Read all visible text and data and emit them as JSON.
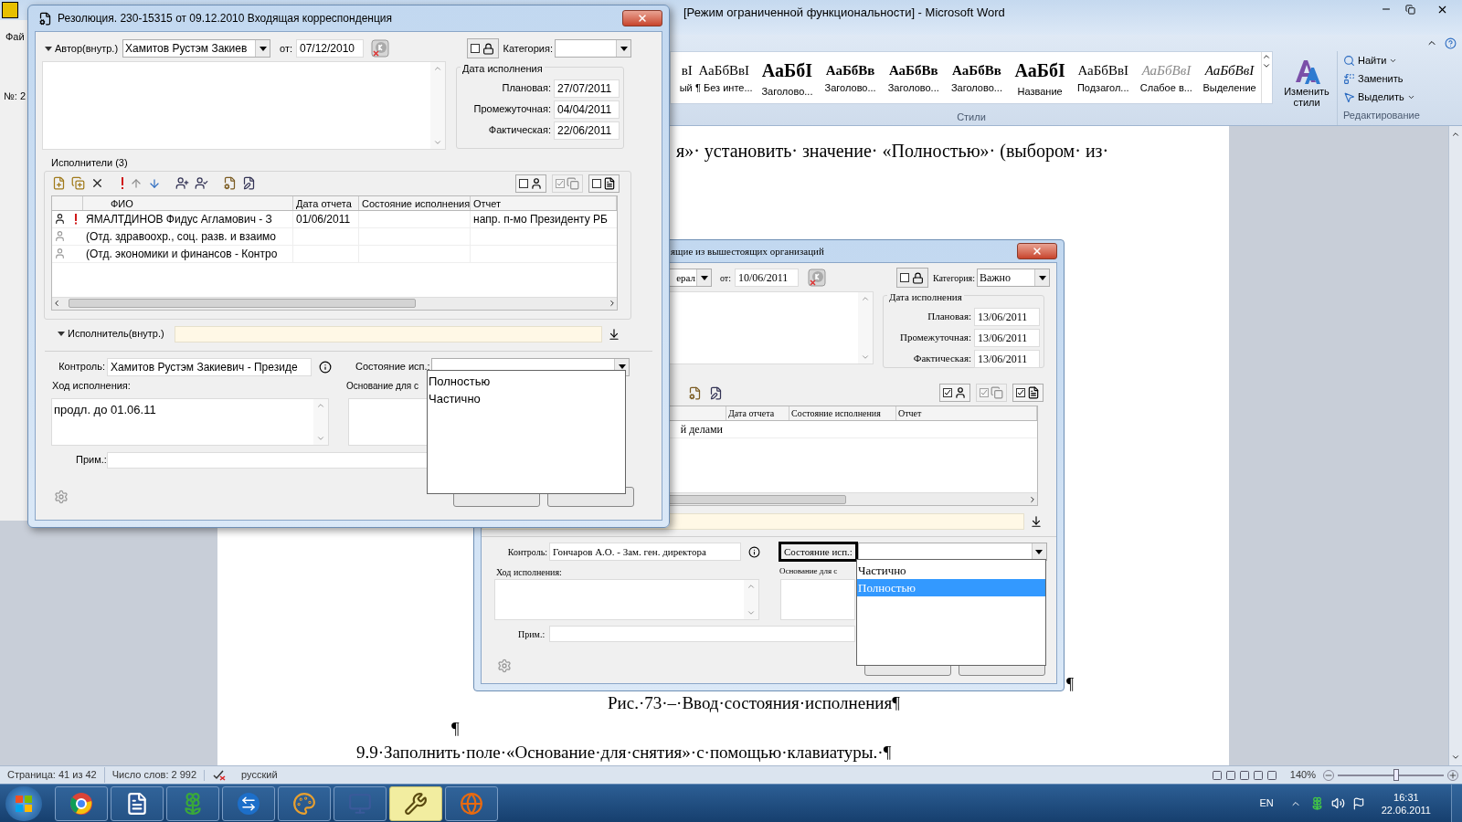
{
  "word": {
    "title": "[Режим ограниченной функциональности] - Microsoft Word",
    "styles": [
      {
        "sample": "вI",
        "name": "ый",
        "kind": "normal"
      },
      {
        "sample": "АаБбВвI",
        "name": "¶ Без инте...",
        "kind": "normal"
      },
      {
        "sample": "АаБбI",
        "name": "Заголово...",
        "kind": "heading1"
      },
      {
        "sample": "АаБбВв",
        "name": "Заголово...",
        "kind": "heading2"
      },
      {
        "sample": "АаБбВв",
        "name": "Заголово...",
        "kind": "heading2"
      },
      {
        "sample": "АаБбВв",
        "name": "Заголово...",
        "kind": "heading2"
      },
      {
        "sample": "АаБбI",
        "name": "Название",
        "kind": "heading1"
      },
      {
        "sample": "АаБбВвI",
        "name": "Подзагол...",
        "kind": "normal"
      },
      {
        "sample": "АаБбВвI",
        "name": "Слабое в...",
        "kind": "subtle"
      },
      {
        "sample": "АаБбВвI",
        "name": "Выделение",
        "kind": "emphasis"
      }
    ],
    "styles_group": "Стили",
    "change_styles": "Изменить стили",
    "editing": [
      {
        "label": "Найти",
        "menu": true
      },
      {
        "label": "Заменить",
        "menu": false
      },
      {
        "label": "Выделить",
        "menu": true
      }
    ],
    "editing_group": "Редактирование"
  },
  "behind_window": {
    "menu": "Фай",
    "number": "№: 2"
  },
  "document": {
    "line": "я»· установить· значение· «Полностью»· (выбором· из·",
    "figure_pilcrow": "¶",
    "caption": "Рис.·73·–·Ввод·состояния·исполнения¶",
    "pilcrow": "¶",
    "paragraph": "9.9·Заполнить·поле·«Основание·для·снятия»·с·помощью·клавиатуры.·¶"
  },
  "figure": {
    "title": "ящие из вышестоящих организаций",
    "author": "ерал",
    "from_label": "от:",
    "date": "10/06/2011",
    "lock": {
      "checked": false
    },
    "category_label": "Категория:",
    "category": "Важно",
    "due_title": "Дата исполнения",
    "due": [
      {
        "label": "Плановая:",
        "value": "13/06/2011"
      },
      {
        "label": "Промежуточная:",
        "value": "13/06/2011"
      },
      {
        "label": "Фактическая:",
        "value": "13/06/2011"
      }
    ],
    "toggles": [
      {
        "checked": true,
        "disabled": false
      },
      {
        "checked": true,
        "disabled": true
      },
      {
        "checked": true,
        "disabled": false
      }
    ],
    "columns": [
      "Дата отчета",
      "Состояние исполнения",
      "Отчет"
    ],
    "rows": [
      {
        "name": "й делами"
      }
    ],
    "control_label": "Контроль:",
    "control": "Гончаров А.О. - Зам. ген. директора",
    "state_label": "Состояние исп.:",
    "state_highlighted": true,
    "options": [
      {
        "label": "Частично",
        "selected": false
      },
      {
        "label": "Полностью",
        "selected": true
      }
    ],
    "progress_label": "Ход исполнения:",
    "basis_label": "Основание для с",
    "note_label": "Прим.:"
  },
  "dialog": {
    "title": "Резолюция. 230-15315 от 09.12.2010 Входящая корреспонденция",
    "author_label": "Автор(внутр.)",
    "author": "Хамитов Рустэм Закиев",
    "from_label": "от:",
    "date": "07/12/2010",
    "lock": {
      "checked": false
    },
    "category_label": "Категория:",
    "due_title": "Дата исполнения",
    "due": [
      {
        "label": "Плановая:",
        "value": "27/07/2011"
      },
      {
        "label": "Промежуточная:",
        "value": "04/04/2011"
      },
      {
        "label": "Фактическая:",
        "value": "22/06/2011"
      }
    ],
    "executors_title": "Исполнители (3)",
    "toggles": [
      {
        "checked": false,
        "disabled": false
      },
      {
        "checked": true,
        "disabled": true
      },
      {
        "checked": false,
        "disabled": false
      }
    ],
    "columns": [
      "ФИО",
      "Дата отчета",
      "Состояние исполнения",
      "Отчет"
    ],
    "rows": [
      {
        "name": "ЯМАЛТДИНОВ Фидус Агламович - З",
        "urgent": true,
        "date": "01/06/2011",
        "report": "напр. п-мо Президенту РБ"
      },
      {
        "name": "(Отд. здравоохр., соц. разв. и взаимо",
        "urgent": false
      },
      {
        "name": "(Отд. экономики и финансов - Контро",
        "urgent": false
      }
    ],
    "executor_label": "Исполнитель(внутр.)",
    "control_label": "Контроль:",
    "control": "Хамитов Рустэм Закиевич - Президе",
    "state_label": "Состояние исп.:",
    "state_highlighted": false,
    "options": [
      {
        "label": "Полностью",
        "selected": false
      },
      {
        "label": "Частично",
        "selected": false
      }
    ],
    "progress_label": "Ход исполнения:",
    "progress": "продл. до 01.06.11",
    "basis_label": "Основание для с",
    "note_label": "Прим.:"
  },
  "status_bar": {
    "page": "Страница: 41 из 42",
    "words": "Число слов: 2 992",
    "language": "русский",
    "zoom": "140%",
    "zoom_slider": {
      "level": 0.55
    }
  },
  "taskbar": {
    "apps": [
      {
        "selected": false
      },
      {
        "selected": false
      },
      {
        "selected": false
      },
      {
        "selected": false
      },
      {
        "selected": false
      },
      {
        "selected": false
      },
      {
        "selected": true
      },
      {
        "selected": false
      }
    ],
    "language": "EN",
    "time": "16:31",
    "date": "22.06.2011"
  }
}
